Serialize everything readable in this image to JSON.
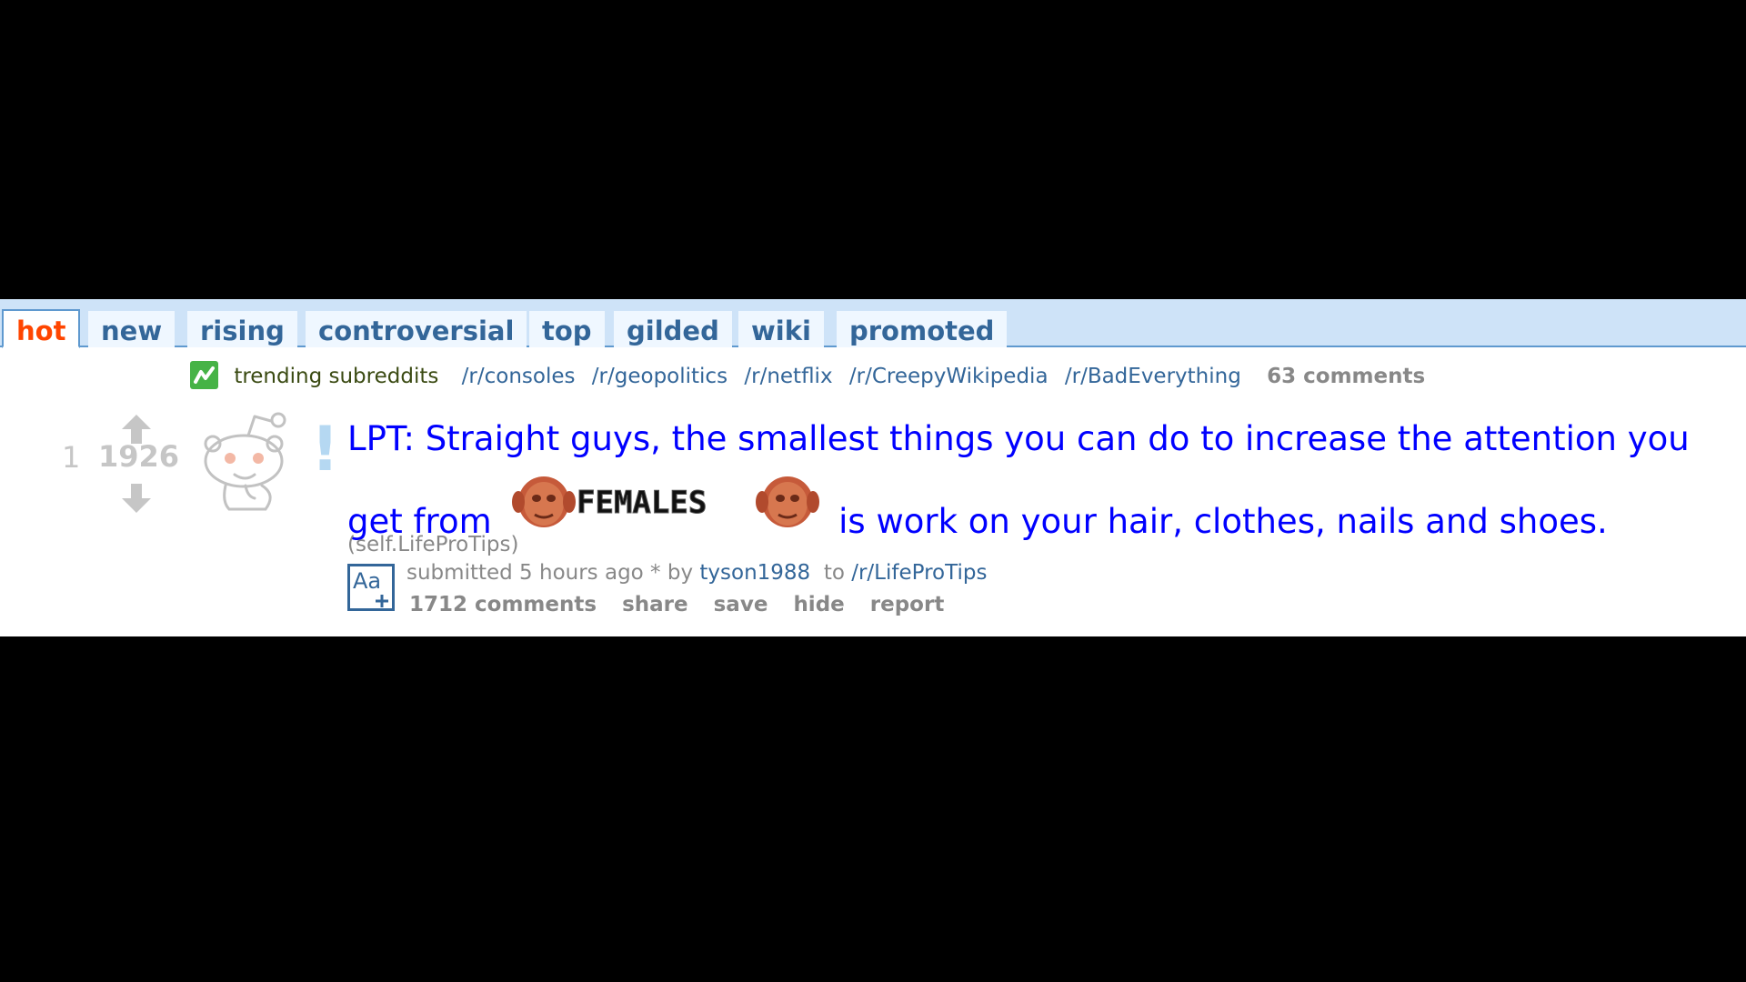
{
  "tabs": [
    {
      "label": "hot",
      "selected": true
    },
    {
      "label": "new"
    },
    {
      "label": "rising"
    },
    {
      "label": "controversial"
    },
    {
      "label": "top"
    },
    {
      "label": "gilded"
    },
    {
      "label": "wiki"
    },
    {
      "label": "promoted"
    }
  ],
  "trending": {
    "label": "trending subreddits",
    "subreddits": [
      "/r/consoles",
      "/r/geopolitics",
      "/r/netflix",
      "/r/CreepyWikipedia",
      "/r/BadEverything"
    ],
    "comments": "63 comments"
  },
  "post": {
    "rank": "1",
    "score": "1926",
    "title_part1": "LPT: Straight guys, the smallest things you can do to increase the attention you get from",
    "title_image_text": "FEMALES",
    "title_part2": "is work on your hair, clothes, nails and shoes.",
    "domain": "(self.LifeProTips)",
    "flair_button": "Aa",
    "submitted": "submitted 5 hours ago * by",
    "author": "tyson1988",
    "to": "to",
    "subreddit": "/r/LifeProTips",
    "buttons": [
      "1712 comments",
      "share",
      "save",
      "hide",
      "report"
    ]
  },
  "colors": {
    "tab_bg": "#eff7ff",
    "tabbar_bg": "#cee3f8",
    "link": "#369",
    "title": "#0000ff",
    "selected_tab": "#ff4500",
    "muted": "#888888",
    "trending_icon": "#46b346"
  },
  "icons": [
    "trending-icon",
    "upvote-arrow-icon",
    "downvote-arrow-icon",
    "reddit-alien-thumbnail-icon",
    "flair-aa-icon"
  ]
}
